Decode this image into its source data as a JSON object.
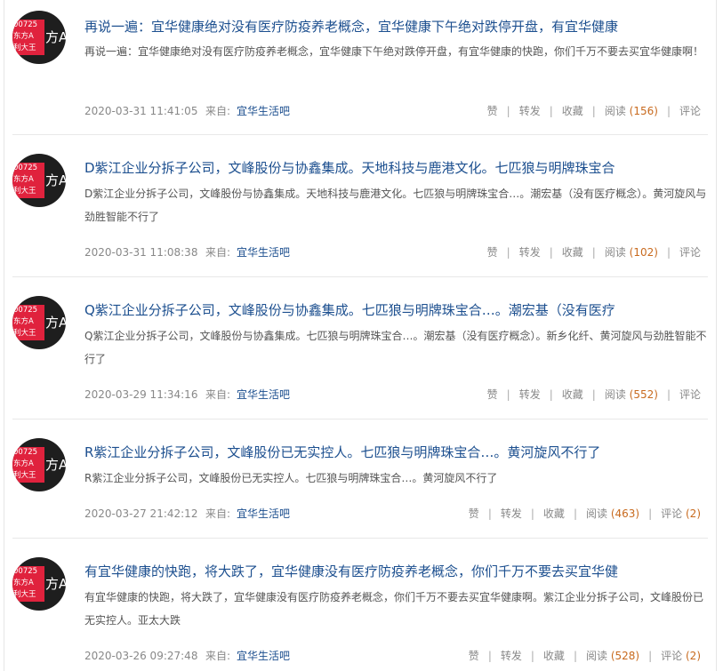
{
  "avatar": {
    "code": "00725",
    "line2": "东方A",
    "line3": "利大王",
    "side": "方A"
  },
  "labels": {
    "source_prefix": "来自:",
    "like": "赞",
    "repost": "转发",
    "favorite": "收藏",
    "read": "阅读",
    "comment": "评论"
  },
  "posts": [
    {
      "title": "再说一遍：宜华健康绝对没有医疗防疫养老概念，宜华健康下午绝对跌停开盘，有宜华健康",
      "summary": "再说一遍：宜华健康绝对没有医疗防疫养老概念，宜华健康下午绝对跌停开盘，有宜华健康的快跑，你们千万不要去买宜华健康啊！",
      "date": "2020-03-31 11:41:05",
      "source": "宜华生活吧",
      "reads": "(156)",
      "comments": ""
    },
    {
      "title": "D紫江企业分拆子公司，文峰股份与协鑫集成。天地科技与鹿港文化。七匹狼与明牌珠宝合",
      "summary": "D紫江企业分拆子公司，文峰股份与协鑫集成。天地科技与鹿港文化。七匹狼与明牌珠宝合…。潮宏基（没有医疗概念）。黄河旋风与劲胜智能不行了",
      "date": "2020-03-31 11:08:38",
      "source": "宜华生活吧",
      "reads": "(102)",
      "comments": ""
    },
    {
      "title": "Q紫江企业分拆子公司，文峰股份与协鑫集成。七匹狼与明牌珠宝合…。潮宏基（没有医疗",
      "summary": "Q紫江企业分拆子公司，文峰股份与协鑫集成。七匹狼与明牌珠宝合…。潮宏基（没有医疗概念）。新乡化纤、黄河旋风与劲胜智能不行了",
      "date": "2020-03-29 11:34:16",
      "source": "宜华生活吧",
      "reads": "(552)",
      "comments": ""
    },
    {
      "title": "R紫江企业分拆子公司，文峰股份已无实控人。七匹狼与明牌珠宝合…。黄河旋风不行了",
      "summary": "R紫江企业分拆子公司，文峰股份已无实控人。七匹狼与明牌珠宝合…。黄河旋风不行了",
      "date": "2020-03-27 21:42:12",
      "source": "宜华生活吧",
      "reads": "(463)",
      "comments": "(2)"
    },
    {
      "title": "有宜华健康的快跑，将大跌了，宜华健康没有医疗防疫养老概念，你们千万不要去买宜华健",
      "summary": "有宜华健康的快跑，将大跌了，宜华健康没有医疗防疫养老概念，你们千万不要去买宜华健康啊。紫江企业分拆子公司，文峰股份已无实控人。亚太大跌",
      "date": "2020-03-26 09:27:48",
      "source": "宜华生活吧",
      "reads": "(528)",
      "comments": "(2)"
    }
  ]
}
